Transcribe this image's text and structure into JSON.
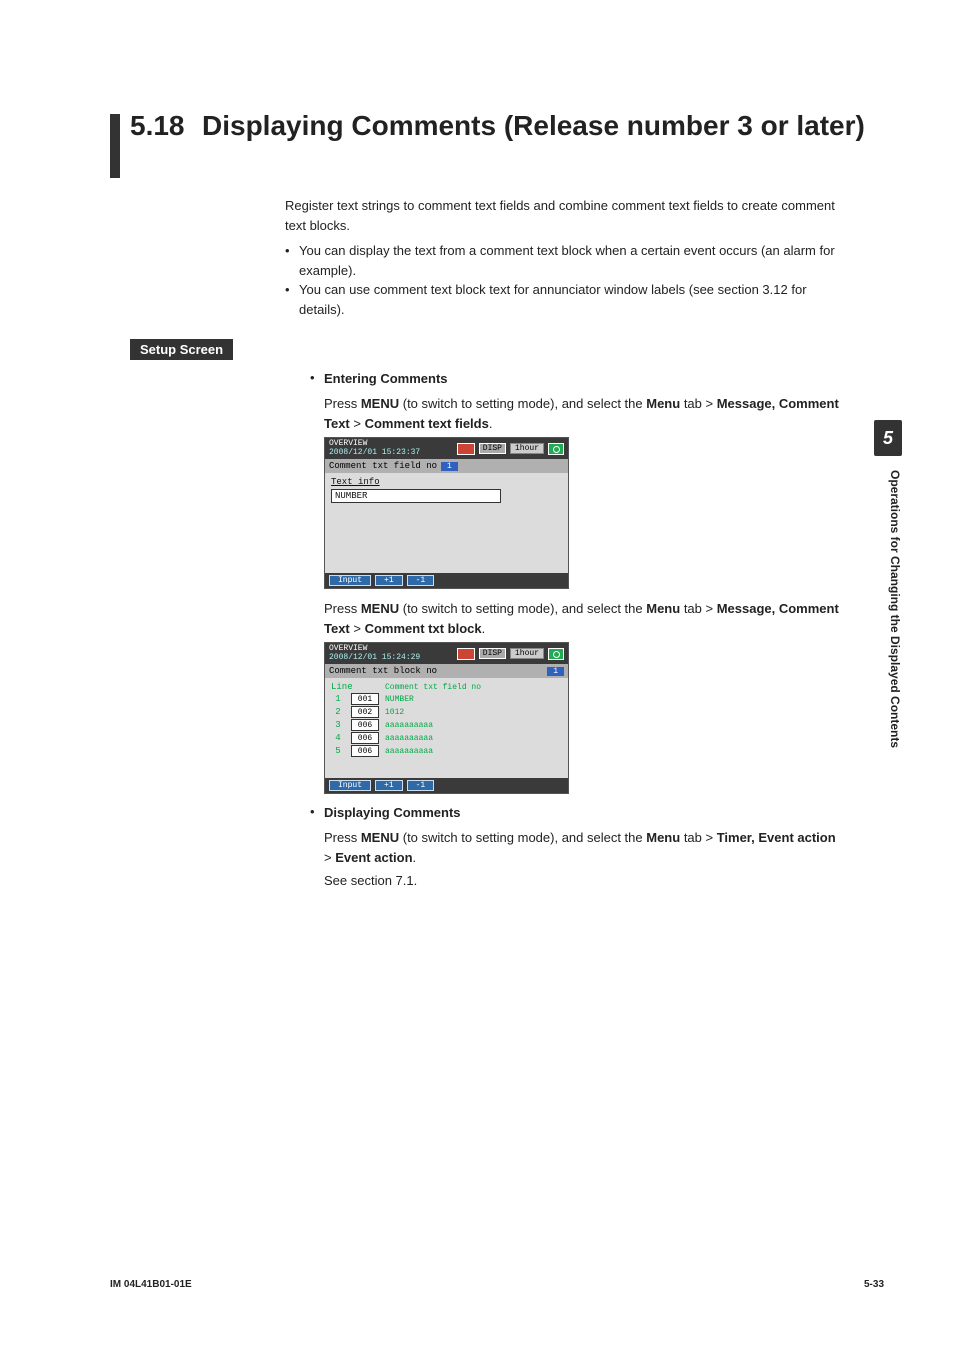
{
  "chapter": {
    "number": "5",
    "side_label": "Operations for Changing the Displayed Contents"
  },
  "title": {
    "num": "5.18",
    "text": "Displaying Comments (Release number 3 or later)"
  },
  "intro": "Register text strings to comment text fields and combine comment text fields to create comment text blocks.",
  "bullets": [
    "You can display the text from a comment text block when a certain event occurs (an alarm for example).",
    "You can use comment text block text for annunciator window labels (see section 3.12 for details)."
  ],
  "setup_label": "Setup Screen",
  "entering": {
    "heading": "Entering Comments",
    "line1_pre": "Press ",
    "line1_menu": "MENU",
    "line1_mid": " (to switch to setting mode), and select the ",
    "line1_menub": "Menu",
    "line1_mid2": " tab > ",
    "line1_msg": "Message, Comment Text",
    "line1_gt": " > ",
    "line1_ctf": "Comment text fields",
    "line1_dot": ".",
    "mock1": {
      "overview": "OVERVIEW",
      "datetime": "2008/12/01 15:23:37",
      "disp": "DISP",
      "hour": "1hour",
      "titlebar": "Comment txt field no",
      "fieldno": "1",
      "textinfo": "Text info",
      "value": "NUMBER",
      "footer": {
        "input": "Input",
        "plus": "+1",
        "minus": "-1"
      }
    },
    "line2_pre": "Press ",
    "line2_menu": "MENU",
    "line2_mid": " (to switch to setting mode), and select the ",
    "line2_menub": "Menu",
    "line2_mid2": " tab > ",
    "line2_msg": "Message, Comment Text",
    "line2_gt": " > ",
    "line2_ctb": "Comment txt block",
    "line2_dot": ".",
    "mock2": {
      "overview": "OVERVIEW",
      "datetime": "2008/12/01 15:24:29",
      "disp": "DISP",
      "hour": "1hour",
      "titlebar": "Comment txt block no",
      "blockno": "1",
      "col_line": "Line",
      "col_field": "Comment txt field no",
      "rows": [
        {
          "line": "1",
          "no": "001",
          "val": "NUMBER"
        },
        {
          "line": "2",
          "no": "002",
          "val": "1012"
        },
        {
          "line": "3",
          "no": "006",
          "val": "aaaaaaaaaa"
        },
        {
          "line": "4",
          "no": "006",
          "val": "aaaaaaaaaa"
        },
        {
          "line": "5",
          "no": "006",
          "val": "aaaaaaaaaa"
        }
      ],
      "footer": {
        "input": "Input",
        "plus": "+1",
        "minus": "-1"
      }
    }
  },
  "displaying": {
    "heading": "Displaying Comments",
    "line1_pre": "Press ",
    "line1_menu": "MENU",
    "line1_mid": " (to switch to setting mode), and select the ",
    "line1_menub": "Menu",
    "line1_mid2": " tab > ",
    "line1_tea": "Timer, Event action",
    "line1_gt": " > ",
    "line1_ea": "Event action",
    "line1_dot": ".",
    "see": "See section 7.1."
  },
  "footer": {
    "left": "IM 04L41B01-01E",
    "right": "5-33"
  }
}
